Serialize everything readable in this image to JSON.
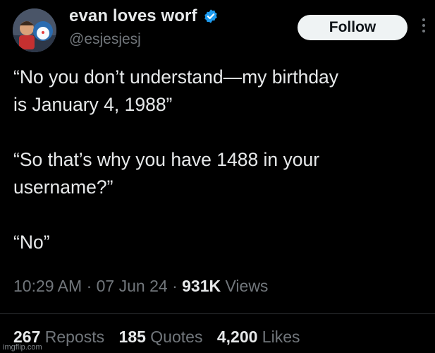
{
  "user": {
    "display_name": "evan loves worf",
    "handle": "@esjesjesj",
    "verified_color": "#1d9bf0"
  },
  "follow_label": "Follow",
  "tweet": {
    "lines": [
      "“No you don’t understand—my birthday",
      "is January 4, 1988”",
      "“So that’s why you have 1488 in your",
      "username?”",
      "“No”"
    ]
  },
  "meta": {
    "time": "10:29 AM",
    "sep": "·",
    "date": "07 Jun 24",
    "views_count": "931K",
    "views_label": "Views"
  },
  "stats": {
    "reposts_count": "267",
    "reposts_label": "Reposts",
    "quotes_count": "185",
    "quotes_label": "Quotes",
    "likes_count": "4,200",
    "likes_label": "Likes"
  },
  "watermark": "imgflip.com"
}
